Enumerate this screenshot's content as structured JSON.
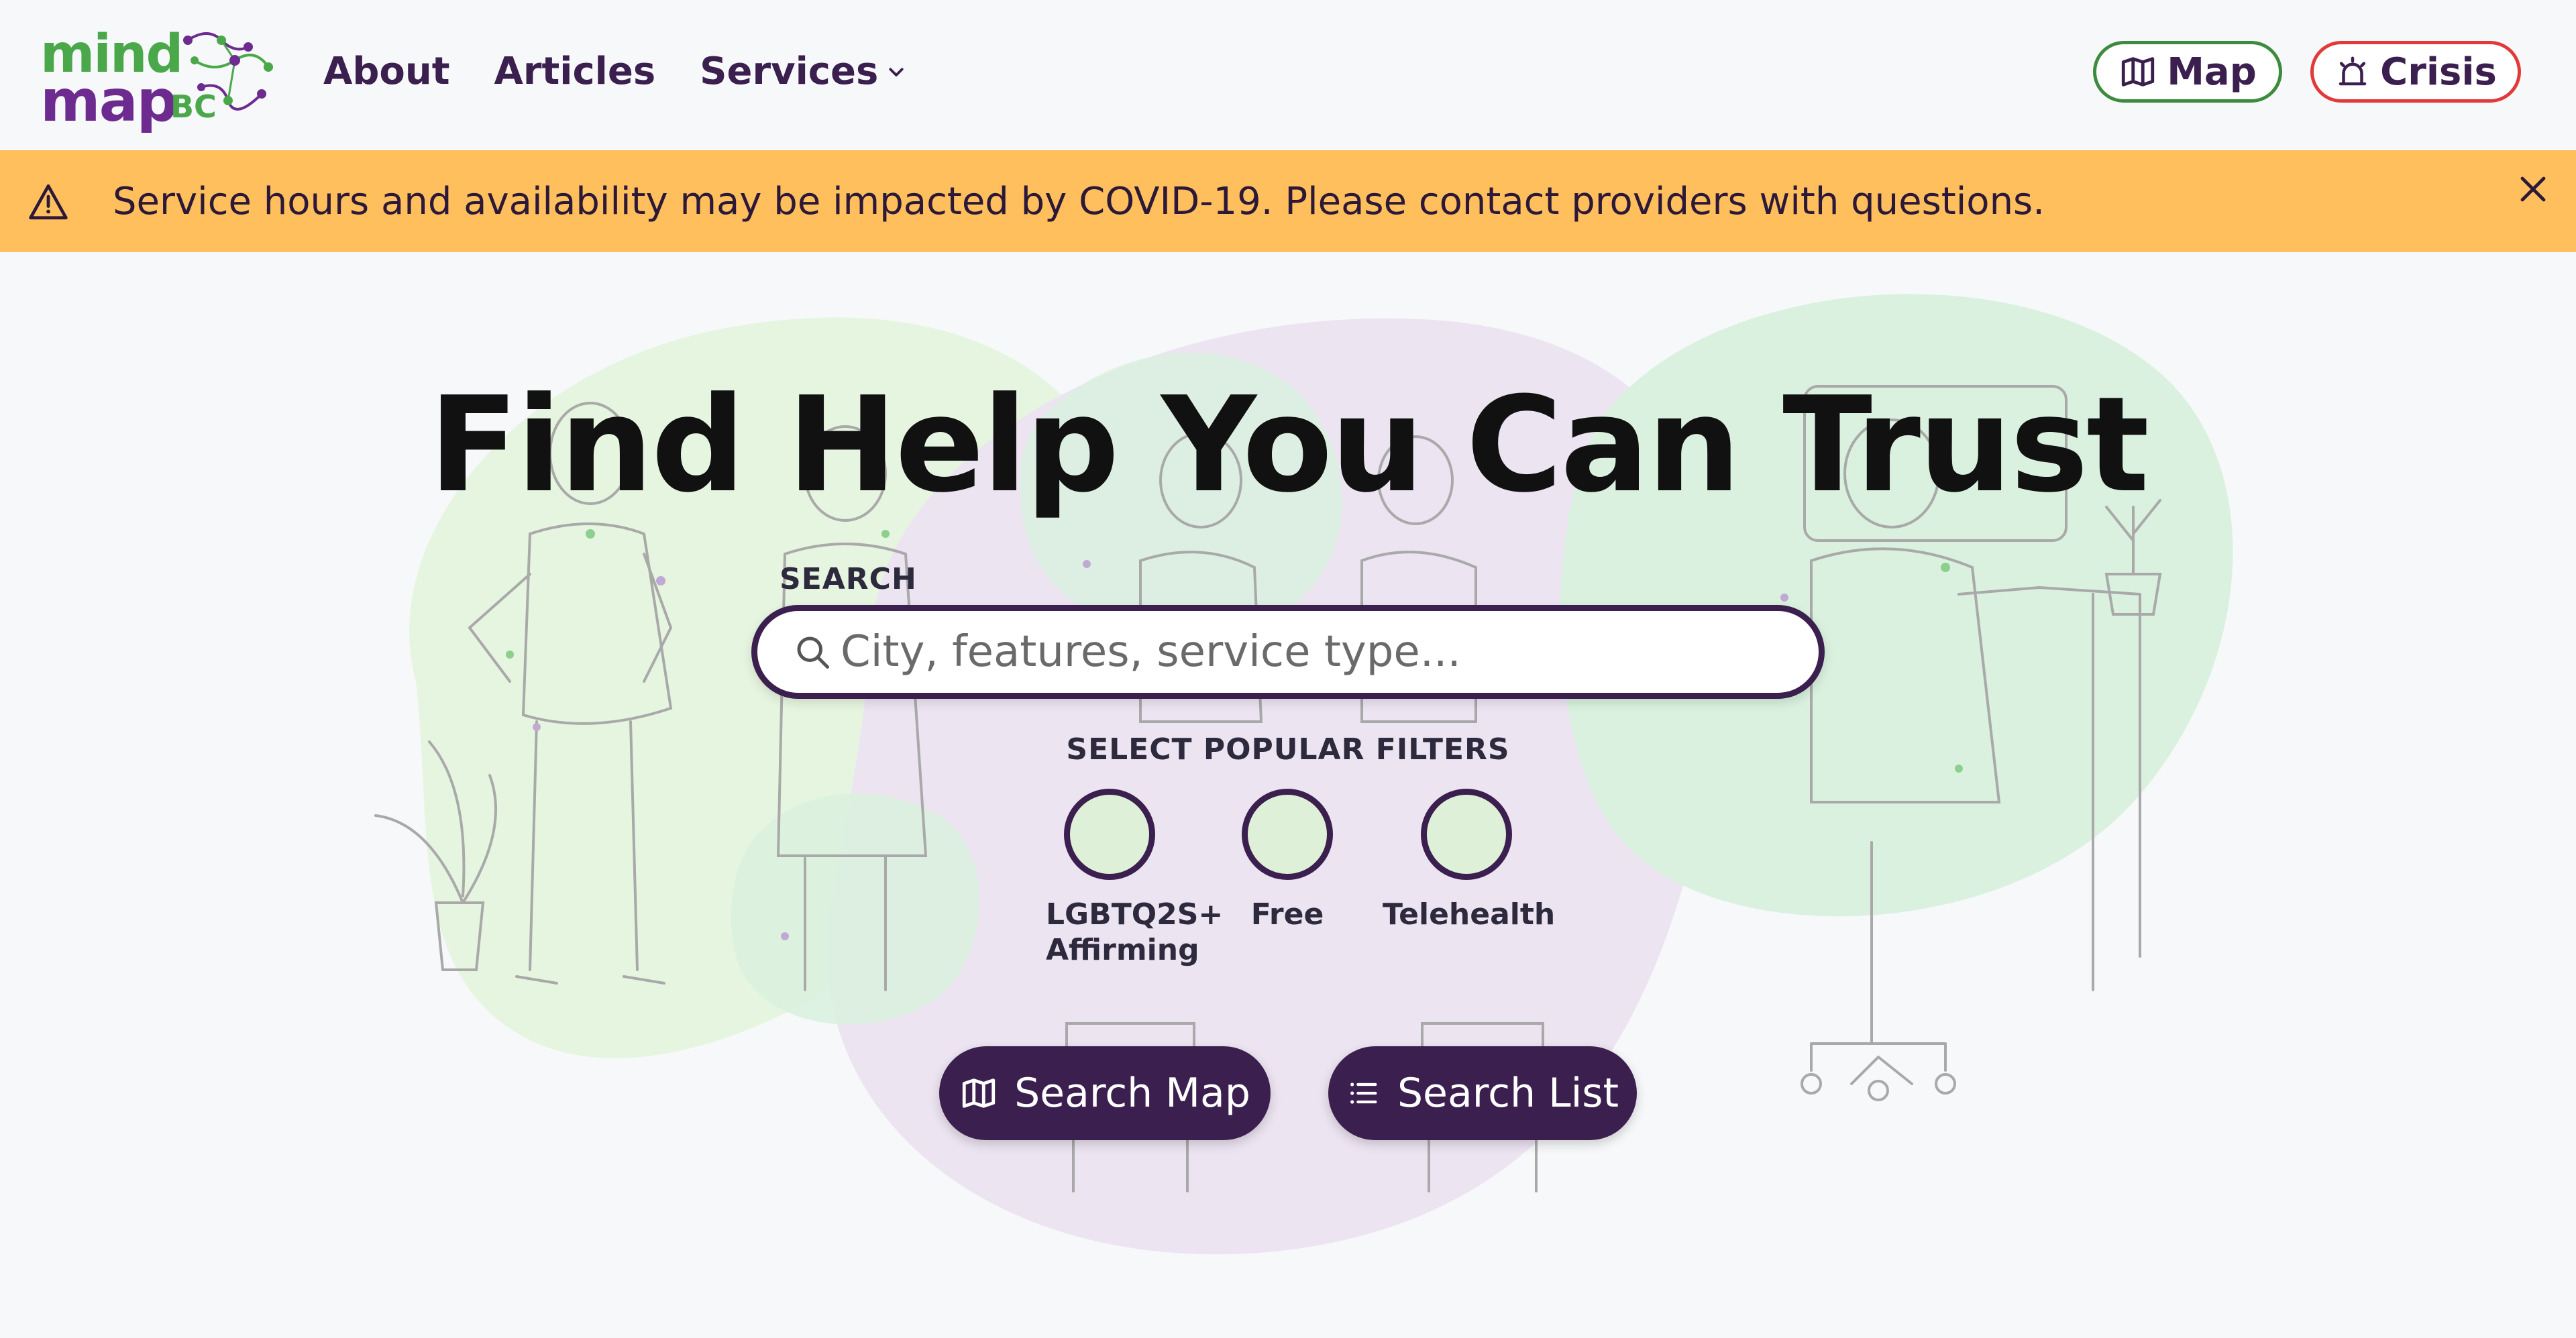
{
  "header": {
    "logo": {
      "mind": "mind",
      "map": "map",
      "bc": "BC"
    },
    "nav": [
      {
        "label": "About"
      },
      {
        "label": "Articles"
      },
      {
        "label": "Services"
      }
    ],
    "map_button": "Map",
    "crisis_button": "Crisis"
  },
  "banner": {
    "text": "Service hours and availability may be impacted by COVID-19. Please contact providers with questions."
  },
  "hero": {
    "title": "Find Help You Can Trust",
    "search_label": "SEARCH",
    "search_placeholder": "City, features, service type...",
    "filters_label": "SELECT POPULAR FILTERS",
    "filters": [
      {
        "label": "LGBTQ2S+ Affirming"
      },
      {
        "label": "Free"
      },
      {
        "label": "Telehealth"
      }
    ],
    "search_map_button": "Search Map",
    "search_list_button": "Search List"
  },
  "colors": {
    "brand_purple": "#3b1f4f",
    "brand_green": "#4aa84a",
    "banner": "#ffbf5c",
    "crisis_red": "#e23a3a",
    "filter_fill": "#dff0d8"
  },
  "icons": [
    "map-icon",
    "alarm-icon",
    "warning-icon",
    "close-icon",
    "search-icon",
    "list-icon",
    "chevron-down-icon"
  ]
}
